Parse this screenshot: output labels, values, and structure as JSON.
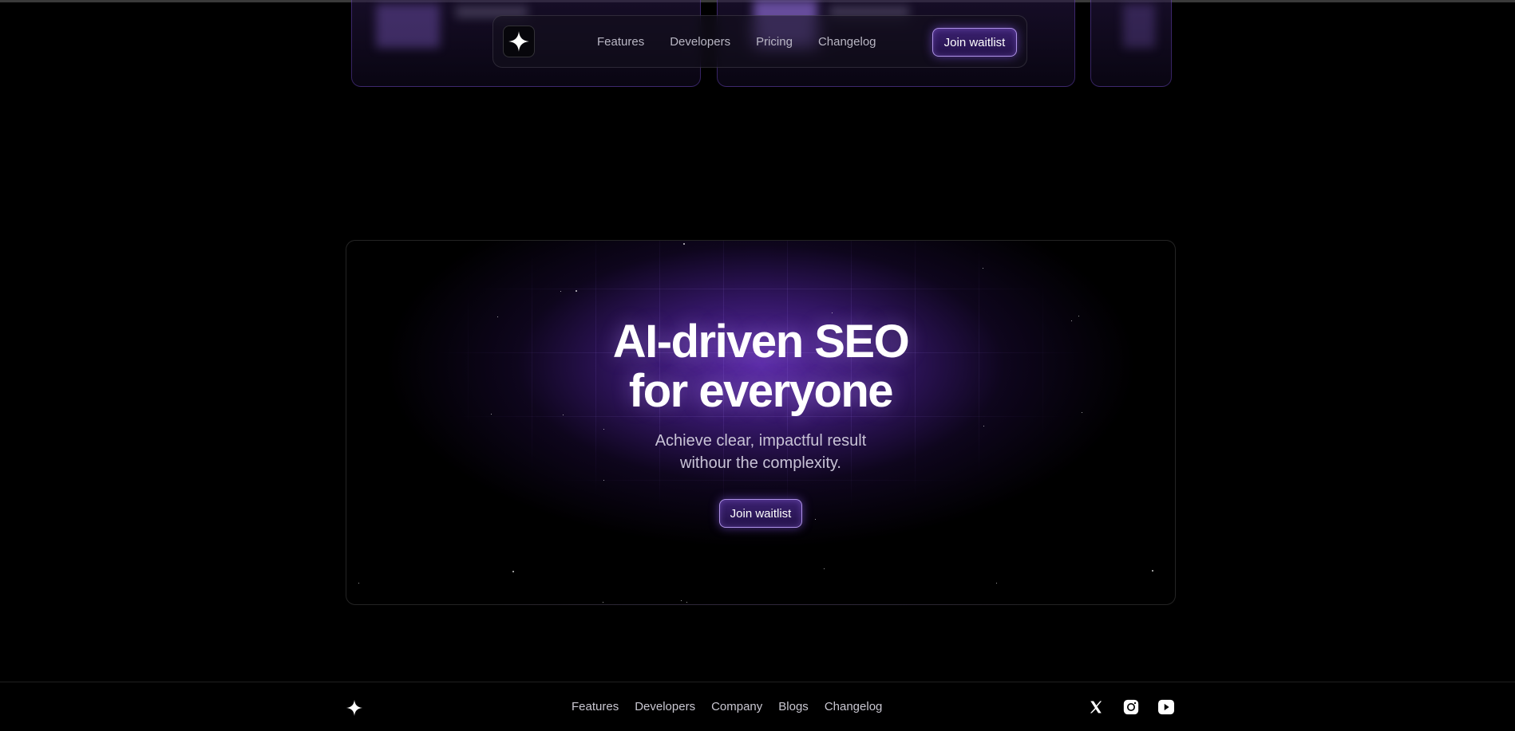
{
  "nav": {
    "links": [
      "Features",
      "Developers",
      "Pricing",
      "Changelog"
    ],
    "cta_label": "Join waitlist"
  },
  "hero": {
    "title_line1": "AI-driven SEO",
    "title_line2": "for everyone",
    "subtitle_line1": "Achieve clear, impactful result",
    "subtitle_line2": "withour the complexity.",
    "cta_label": "Join waitlist",
    "accent_color": "#6b33c4"
  },
  "footer": {
    "links": [
      "Features",
      "Developers",
      "Company",
      "Blogs",
      "Changelog"
    ],
    "social_icons": [
      "x-icon",
      "instagram-icon",
      "youtube-icon"
    ]
  }
}
